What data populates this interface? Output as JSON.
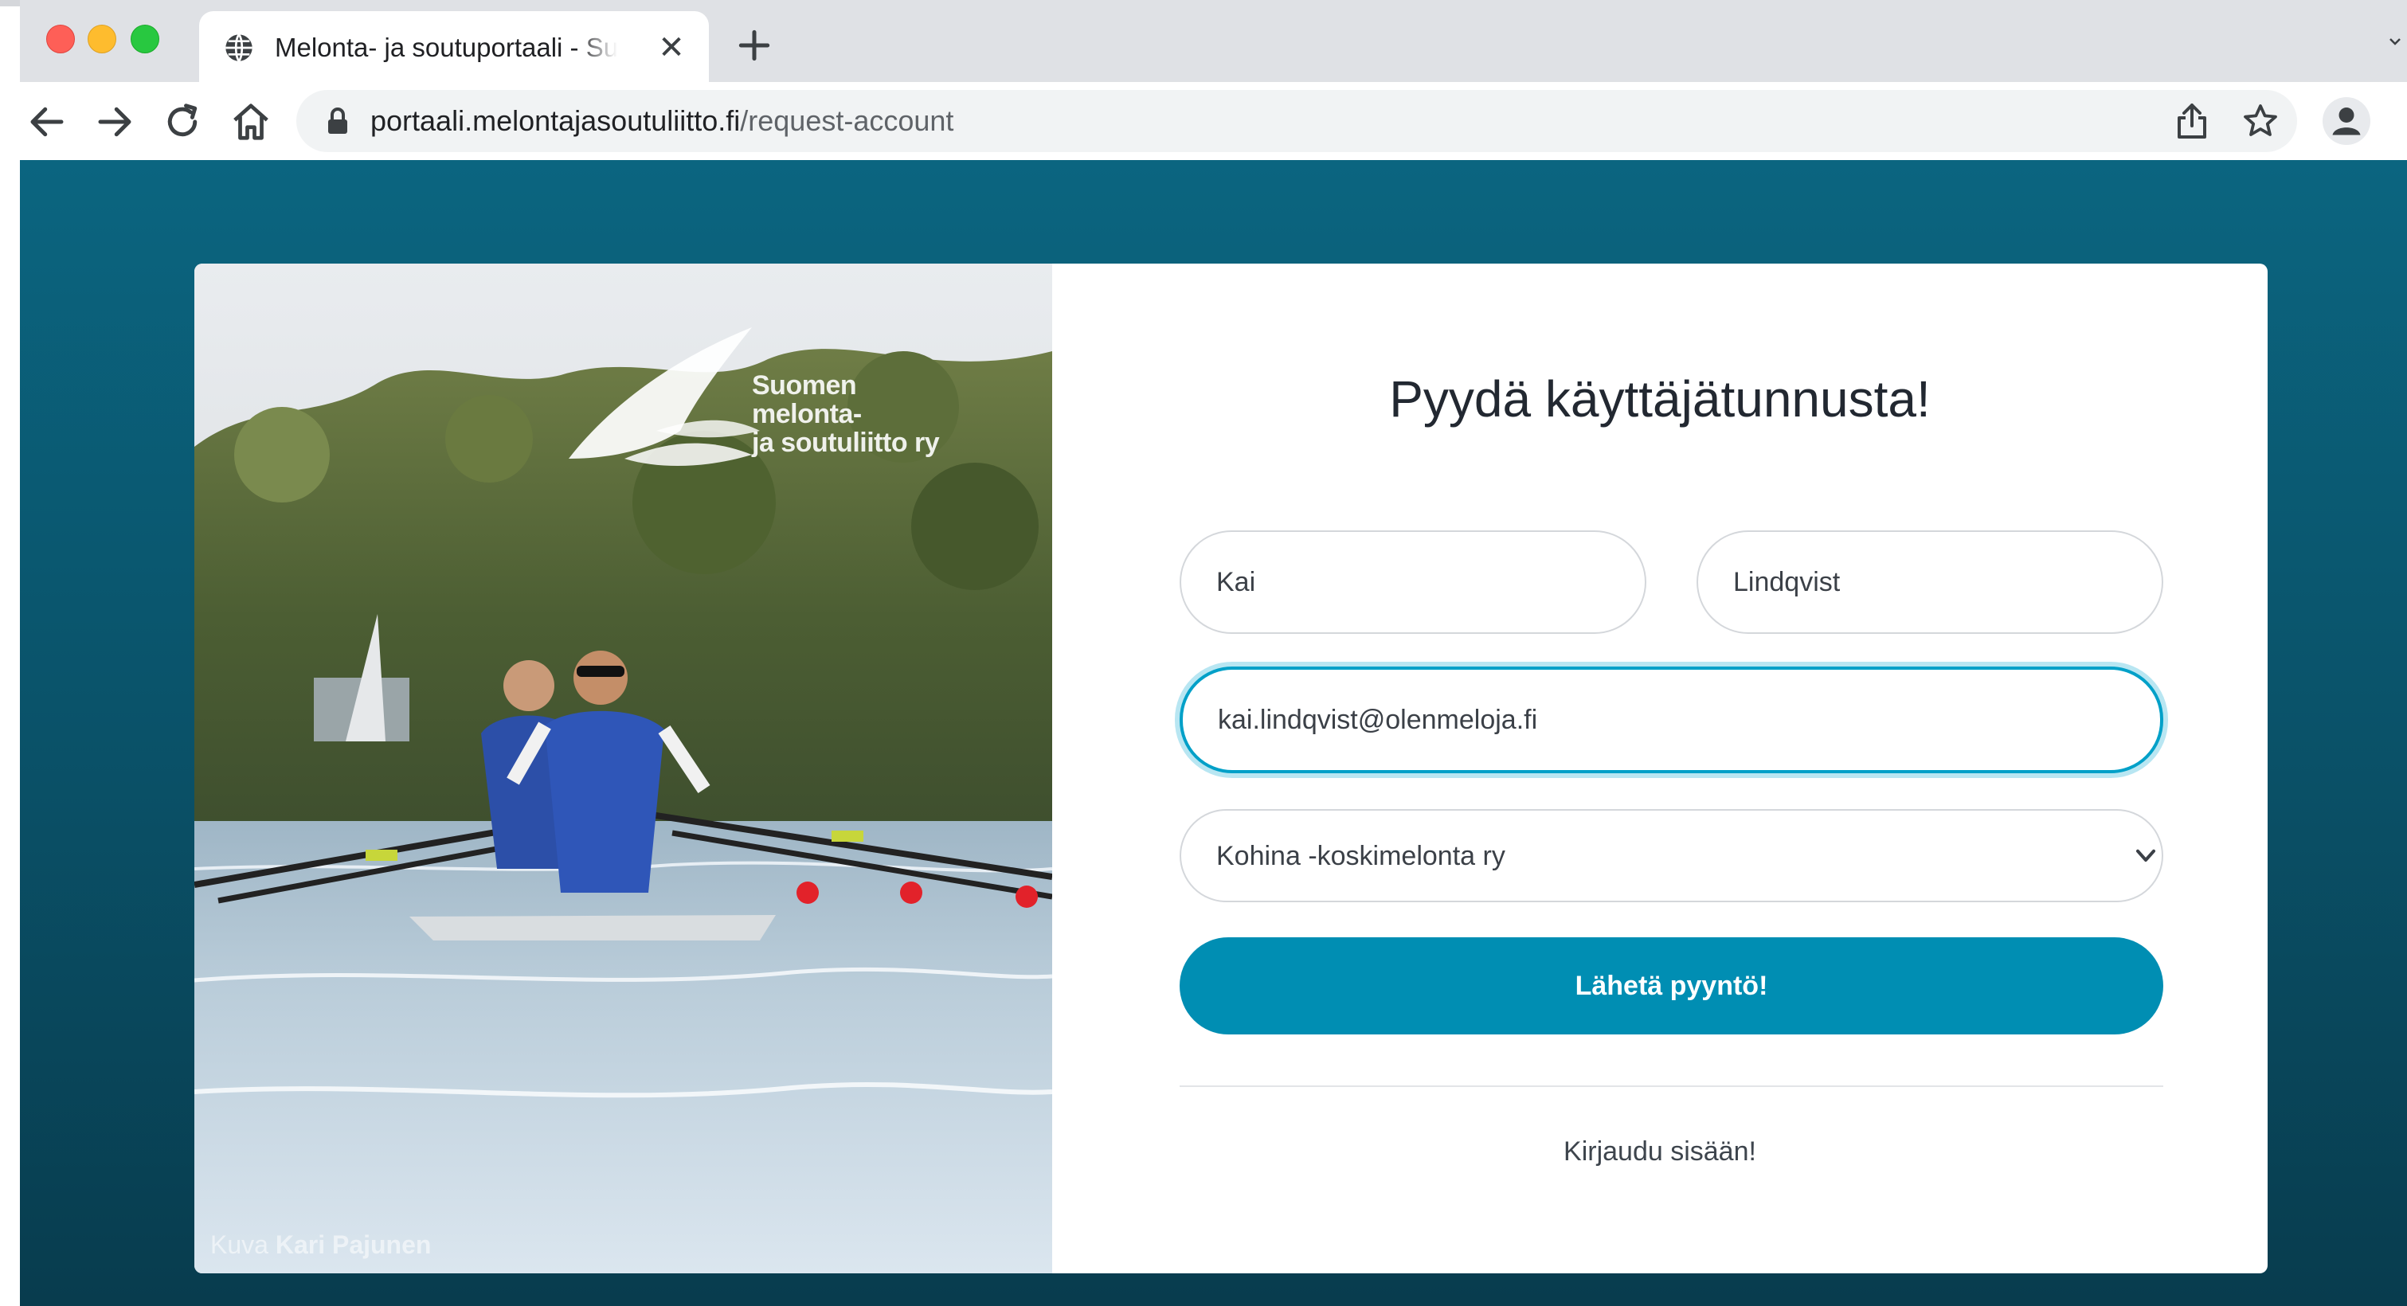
{
  "browser": {
    "tab_title": "Melonta- ja soutuportaali - Suomen melonta- ja soutuliitto ry",
    "tab_close": "✕",
    "url_host": "portaali.melontajasoutuliitto.fi",
    "url_path": "/request-account"
  },
  "photo": {
    "logo_lines": [
      "Suomen",
      "melonta-",
      "ja soutuliitto ry"
    ],
    "credit_prefix": "Kuva",
    "credit_name": "Kari Pajunen"
  },
  "form": {
    "title": "Pyydä käyttäjätunnusta!",
    "first_name": "Kai",
    "last_name": "Lindqvist",
    "email": "kai.lindqvist@olenmeloja.fi",
    "club_selected": "Kohina -koskimelonta ry",
    "submit_label": "Lähetä pyyntö!",
    "login_link": "Kirjaudu sisään!"
  },
  "icons": {
    "tab": "globe-icon",
    "new_tab": "plus-icon",
    "back": "arrow-left-icon",
    "forward": "arrow-right-icon",
    "reload": "reload-icon",
    "home": "home-icon",
    "lock": "lock-icon",
    "share": "share-icon",
    "bookmark": "star-icon",
    "profile": "profile-icon",
    "select": "chevron-down-icon"
  },
  "colors": {
    "page_background": "#0a5269",
    "primary_button": "#008eb3",
    "focus_border": "#00a0c8"
  }
}
